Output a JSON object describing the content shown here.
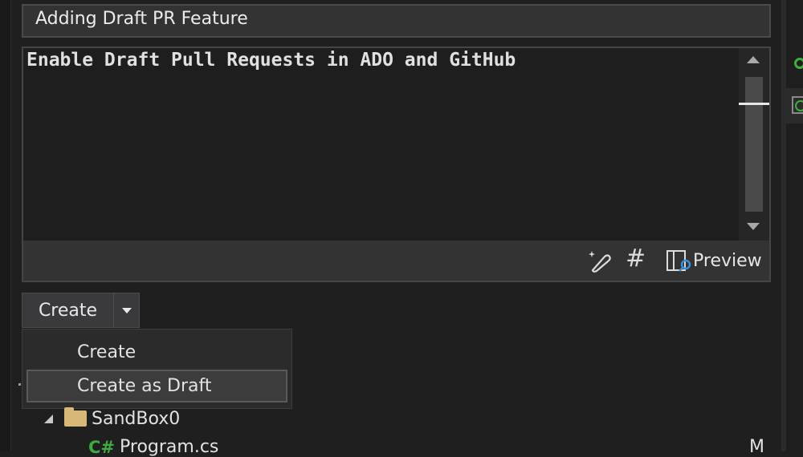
{
  "pr_title": {
    "value": "Adding Draft PR Feature"
  },
  "description": {
    "value": "Enable Draft Pull Requests in ADO and GitHub",
    "toolbar": {
      "copilot_icon": "magic-wand-icon",
      "hash_icon": "hash-icon",
      "preview_icon": "preview-icon",
      "preview_label": "Preview"
    }
  },
  "create_button": {
    "label": "Create",
    "dropdown_icon": "chevron-down-icon",
    "menu": [
      {
        "label": "Create",
        "selected": false
      },
      {
        "label": "Create as Draft",
        "selected": true
      }
    ]
  },
  "tree": {
    "folder": {
      "label": "SandBox0",
      "icon": "folder-icon",
      "expanded": true
    },
    "files": [
      {
        "label": "Program.cs",
        "icon_text": "C#",
        "status": "M"
      }
    ]
  },
  "colors": {
    "background": "#1f1f1f",
    "accent_green": "#3faa3f",
    "preview_accent": "#3a8fd8",
    "folder": "#d8b878"
  }
}
